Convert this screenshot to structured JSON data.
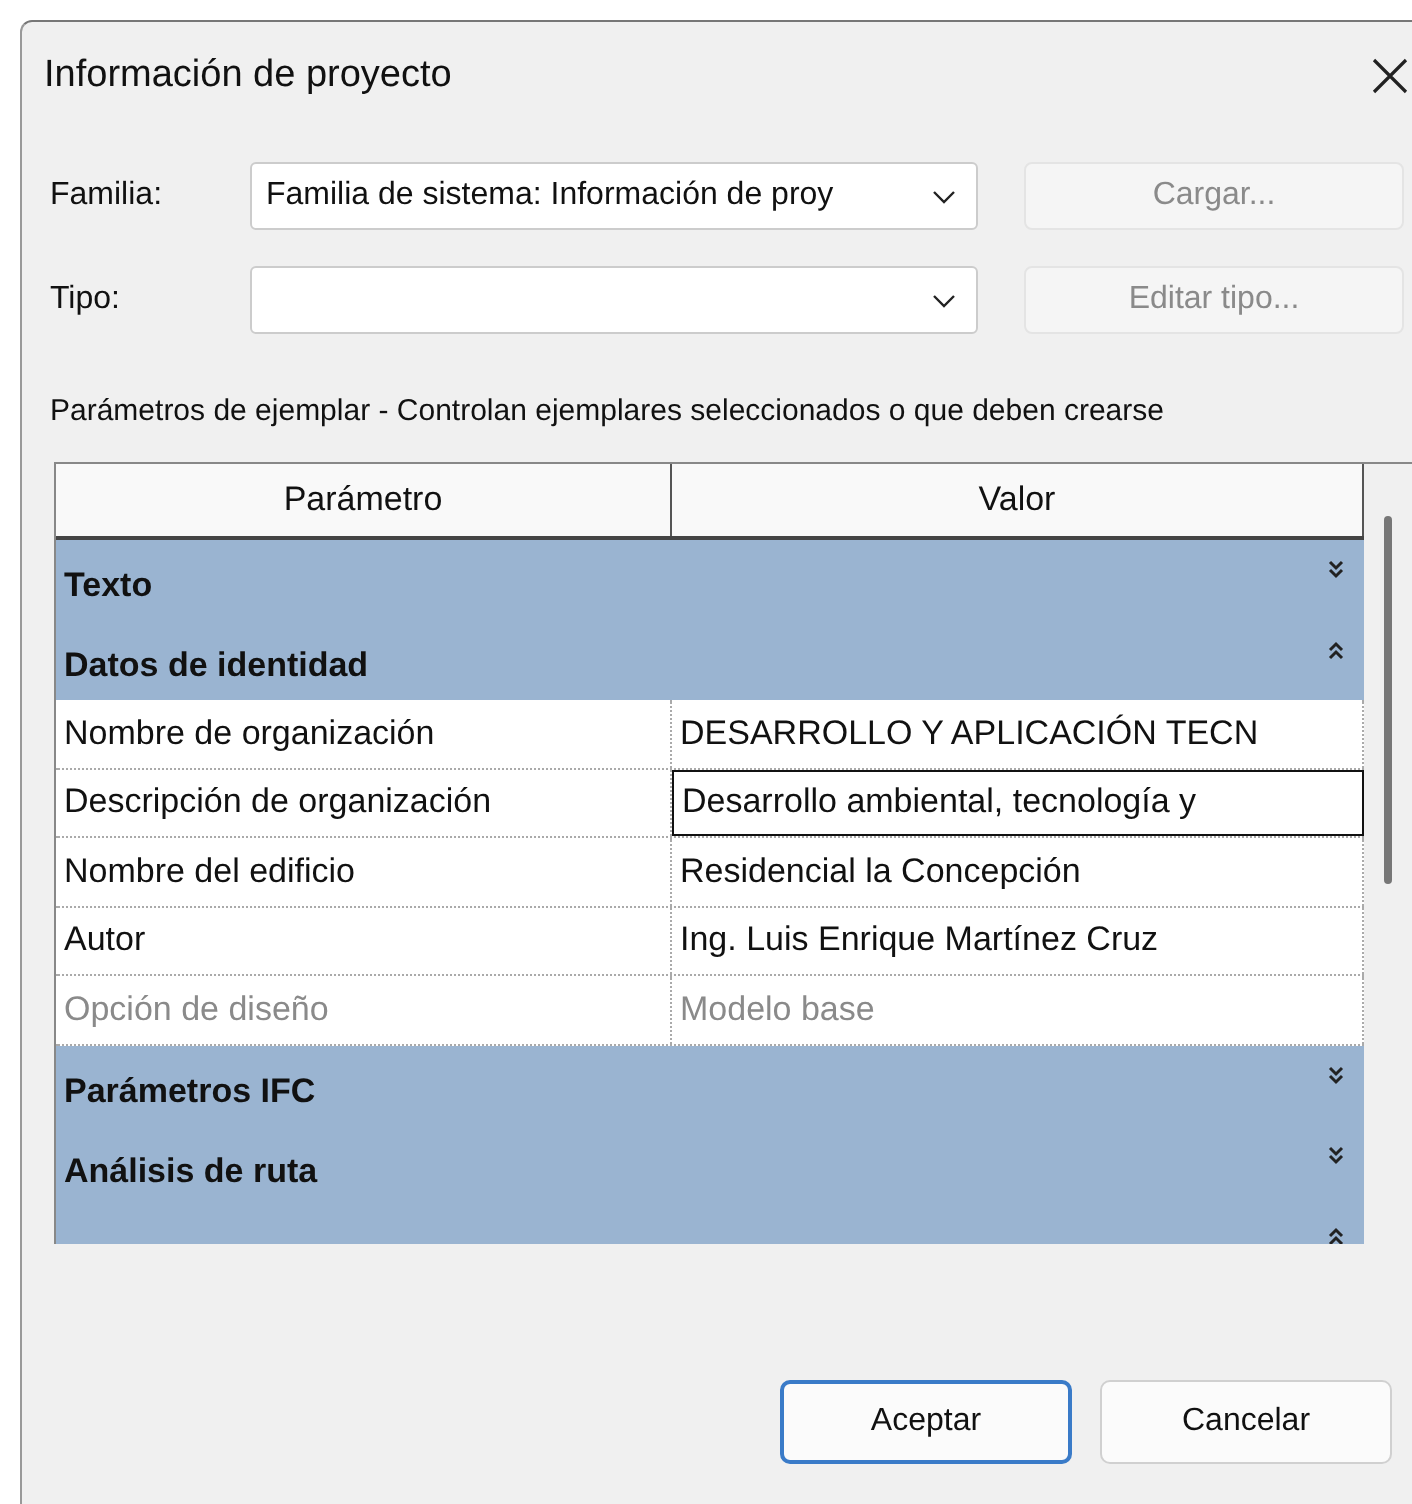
{
  "window": {
    "title": "Información de proyecto"
  },
  "fields": [
    {
      "label": "Familia:",
      "value": "Familia de sistema: Información de proy",
      "button": {
        "label": "Cargar...",
        "disabled": true
      }
    },
    {
      "label": "Tipo:",
      "button": {
        "label": "Editar tipo...",
        "disabled": true
      }
    }
  ],
  "caption": "Parámetros de ejemplar - Controlan ejemplares seleccionados o que deben crearse",
  "table": {
    "columns": [
      "Parámetro",
      "Valor"
    ],
    "rows": [
      {
        "kind": "group",
        "label": "Texto",
        "expanded": false
      },
      {
        "kind": "group",
        "label": "Datos de identidad",
        "expanded": true
      },
      {
        "kind": "param",
        "name": "Nombre de organización",
        "value": "DESARROLLO Y APLICACIÓN TECN",
        "disabled": false,
        "selected": false
      },
      {
        "kind": "param",
        "name": "Descripción de organización",
        "value": "Desarrollo ambiental, tecnología y",
        "disabled": false,
        "selected": true
      },
      {
        "kind": "param",
        "name": "Nombre del edificio",
        "value": "Residencial la Concepción",
        "disabled": false,
        "selected": false
      },
      {
        "kind": "param",
        "name": "Autor",
        "value": "Ing. Luis Enrique Martínez Cruz",
        "disabled": false,
        "selected": false
      },
      {
        "kind": "param",
        "name": "Opción de diseño",
        "value": "Modelo base",
        "disabled": true,
        "selected": false
      },
      {
        "kind": "group",
        "label": "Parámetros IFC",
        "expanded": false
      },
      {
        "kind": "group",
        "label": "Análisis de ruta",
        "expanded": false
      },
      {
        "kind": "group",
        "expanded": true
      }
    ]
  },
  "buttons": [
    {
      "label": "Aceptar",
      "default": true
    },
    {
      "label": "Cancelar",
      "default": false
    }
  ]
}
